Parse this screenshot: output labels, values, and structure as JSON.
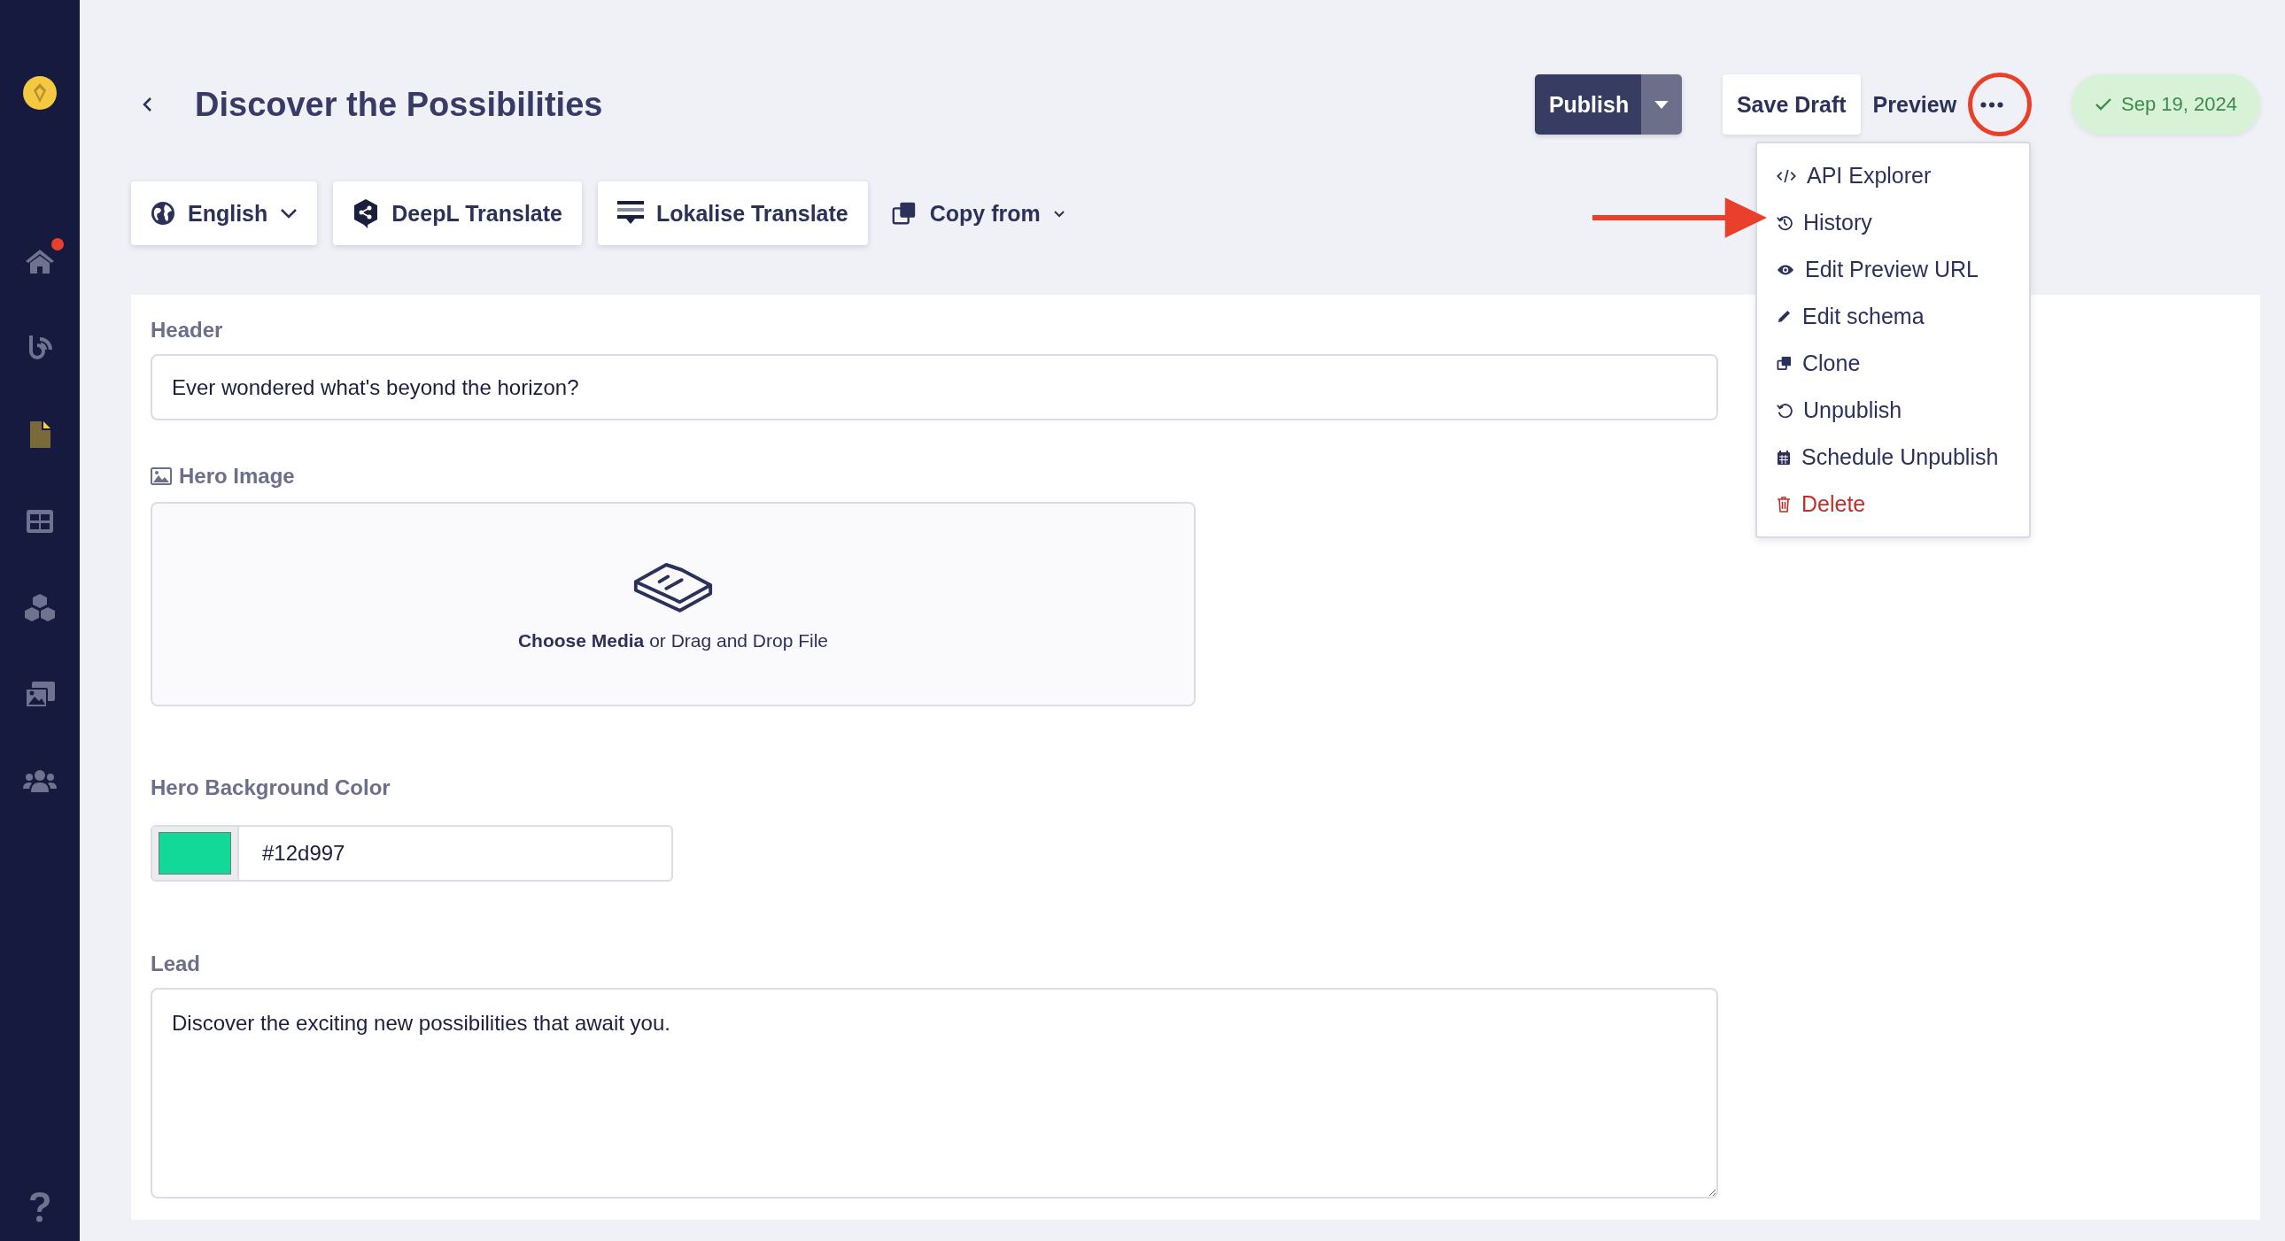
{
  "sidebar": {
    "items": [
      {
        "kind": "home",
        "selected": false,
        "notification": true
      },
      {
        "kind": "feed",
        "selected": false,
        "notification": false
      },
      {
        "kind": "document",
        "selected": true,
        "notification": false
      },
      {
        "kind": "layout",
        "selected": false,
        "notification": false
      },
      {
        "kind": "blocks",
        "selected": false,
        "notification": false
      },
      {
        "kind": "media",
        "selected": false,
        "notification": false
      },
      {
        "kind": "users",
        "selected": false,
        "notification": false
      }
    ]
  },
  "header": {
    "title": "Discover the Possibilities",
    "publish": "Publish",
    "save_draft": "Save Draft",
    "preview": "Preview",
    "status_date": "Sep 19, 2024"
  },
  "toolbar": {
    "language": "English",
    "deepl": "DeepL Translate",
    "lokalise": "Lokalise Translate",
    "copy_from": "Copy from"
  },
  "menu": {
    "items": [
      {
        "label": "API Explorer",
        "kind": "normal"
      },
      {
        "label": "History",
        "kind": "normal"
      },
      {
        "label": "Edit Preview URL",
        "kind": "normal"
      },
      {
        "label": "Edit schema",
        "kind": "normal"
      },
      {
        "label": "Clone",
        "kind": "normal"
      },
      {
        "label": "Unpublish",
        "kind": "normal"
      },
      {
        "label": "Schedule Unpublish",
        "kind": "normal"
      },
      {
        "label": "Delete",
        "kind": "danger"
      }
    ]
  },
  "form": {
    "header": {
      "label": "Header",
      "value": "Ever wondered what's beyond the horizon?"
    },
    "hero_image": {
      "label": "Hero Image",
      "prompt": "**Choose Media** or Drag and Drop File"
    },
    "hero_color": {
      "label": "Hero Background Color",
      "value": "#12d997"
    },
    "lead": {
      "label": "Lead",
      "value": "Discover the exciting new possibilities that await you."
    }
  }
}
